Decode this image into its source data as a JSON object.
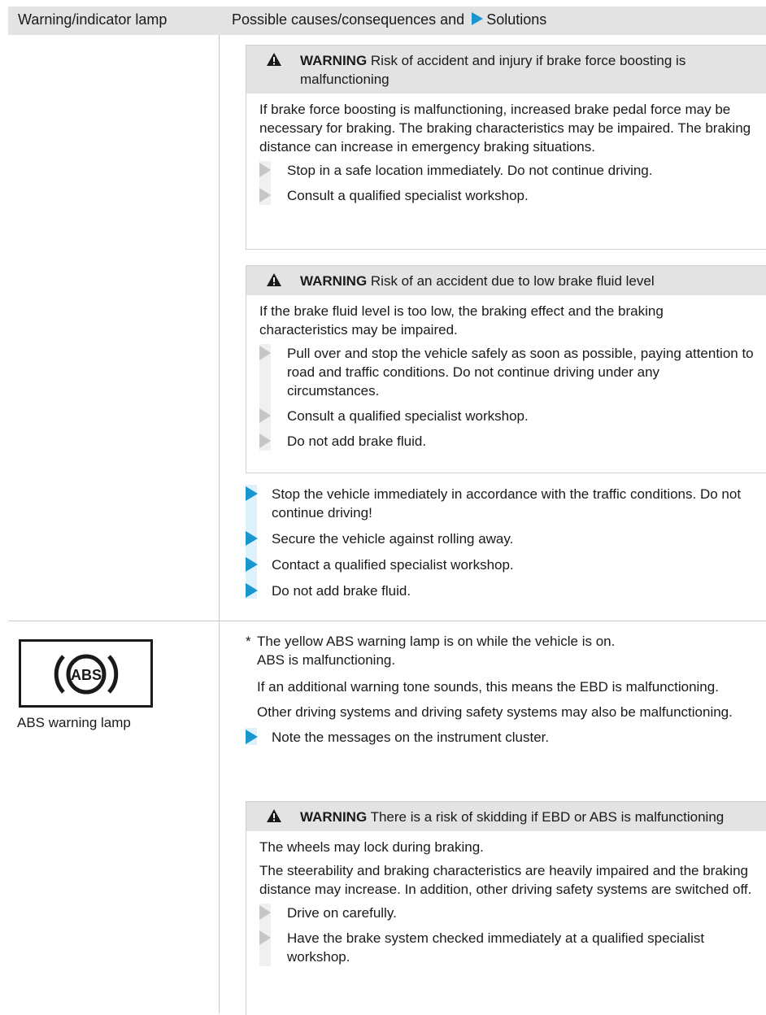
{
  "header": {
    "col1": "Warning/indicator lamp",
    "col2_pre": "Possible causes/consequences and",
    "col2_post": "Solutions"
  },
  "warning1": {
    "keyword": "WARNING",
    "title": "Risk of accident and injury if brake force boosting is malfunctioning",
    "body": "If brake force boosting is malfunctioning, increased brake pedal force may be necessary for braking. The braking characteristics may be impaired. The braking distance can increase in emergency braking situations.",
    "steps": [
      "Stop in a safe location immediately. Do not continue driving.",
      "Consult a qualified specialist workshop."
    ]
  },
  "warning2": {
    "keyword": "WARNING",
    "title": "Risk of an accident due to low brake fluid level",
    "body": "If the brake fluid level is too low, the braking effect and the braking characteristics may be impaired.",
    "steps": [
      "Pull over and stop the vehicle safely as soon as possible, paying attention to road and traffic conditions. Do not continue driving under any circumstances.",
      "Consult a qualified specialist workshop.",
      "Do not add brake fluid."
    ]
  },
  "solutions1": [
    "Stop the vehicle immediately in accordance with the traffic conditions. Do not continue driving!",
    "Secure the vehicle against rolling away.",
    "Contact a qualified specialist workshop.",
    "Do not add brake fluid."
  ],
  "abs": {
    "lamp_text": "ABS",
    "lamp_label": "ABS warning lamp",
    "asterisk": "*",
    "line1": "The yellow ABS warning lamp is on while the vehicle is on.",
    "line2": "ABS is malfunctioning.",
    "para2": "If an additional warning tone sounds, this means the EBD is malfunctioning.",
    "para3": "Other driving systems and driving safety systems may also be malfunctioning.",
    "step": "Note the messages on the instrument cluster."
  },
  "warning3": {
    "keyword": "WARNING",
    "title": "There is a risk of skidding if EBD or ABS is malfunctioning",
    "body1": "The wheels may lock during braking.",
    "body2": "The steerability and braking characteristics are heavily impaired and the braking distance may increase. In addition, other driving safety systems are switched off.",
    "steps": [
      "Drive on carefully.",
      "Have the brake system checked immediately at a qualified specialist workshop."
    ]
  }
}
